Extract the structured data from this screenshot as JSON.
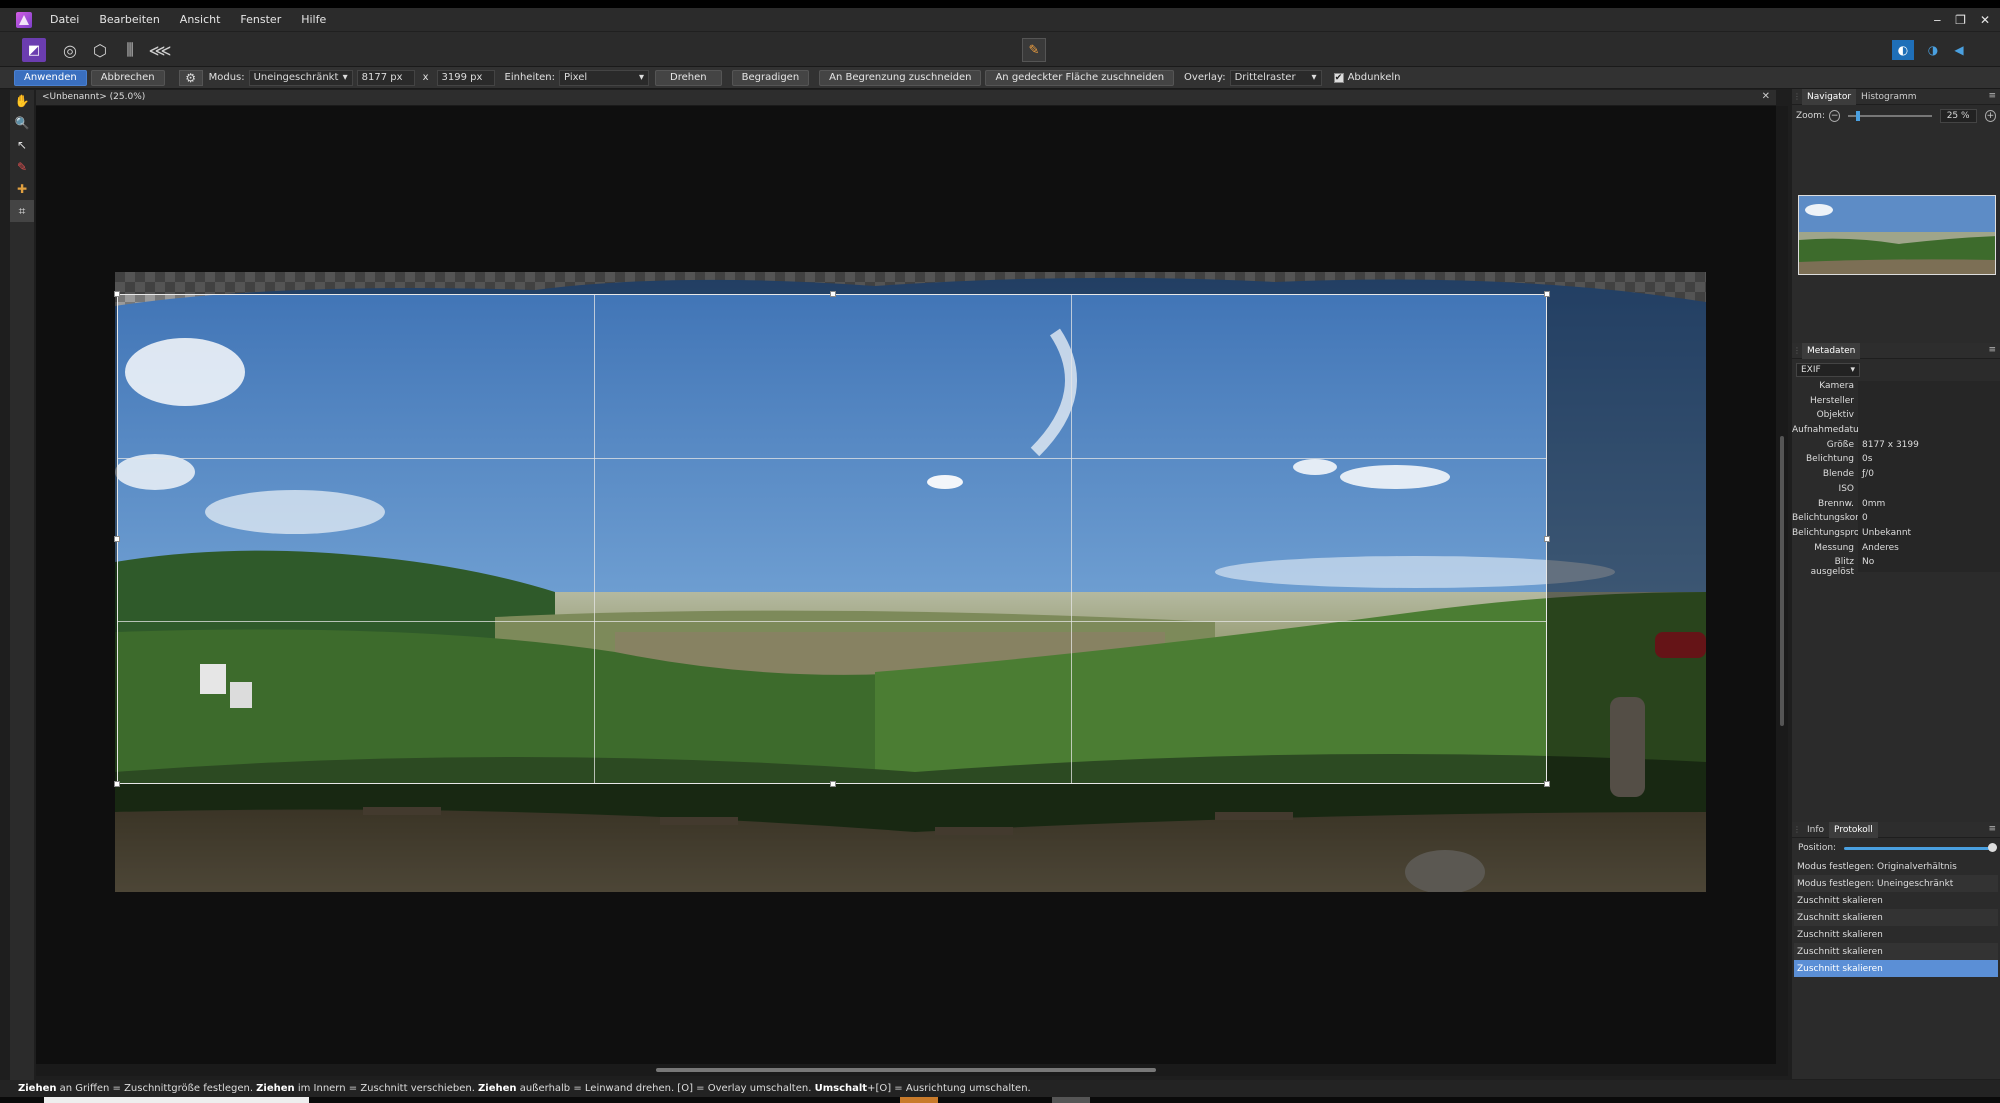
{
  "menubar": {
    "items": [
      "Datei",
      "Bearbeiten",
      "Ansicht",
      "Fenster",
      "Hilfe"
    ],
    "window_controls": [
      "‒",
      "❐",
      "✕"
    ]
  },
  "toolbar": {
    "personas": [
      "photo-persona-icon",
      "liquify-persona-icon",
      "develop-persona-icon",
      "tone-mapping-persona-icon",
      "export-persona-icon"
    ]
  },
  "context_toolbar": {
    "apply_label": "Anwenden",
    "cancel_label": "Abbrechen",
    "mode_label": "Modus:",
    "mode_value": "Uneingeschränkt",
    "width_value": "8177 px",
    "x_label": "x",
    "height_value": "3199 px",
    "units_label": "Einheiten:",
    "units_value": "Pixel",
    "rotate_label": "Drehen",
    "straighten_label": "Begradigen",
    "crop_to_bounds_label": "An Begrenzung zuschneiden",
    "crop_to_covered_label": "An gedeckter Fläche zuschneiden",
    "overlay_label": "Overlay:",
    "overlay_value": "Drittelraster",
    "darken_label": "Abdunkeln",
    "darken_checked": true
  },
  "document": {
    "tab_title": "<Unbenannt> (25.0%)"
  },
  "navigator": {
    "tabs": [
      "Navigator",
      "Histogramm"
    ],
    "zoom_label": "Zoom:",
    "zoom_value": "25 %"
  },
  "metadata": {
    "tab": "Metadaten",
    "select_value": "EXIF",
    "rows": [
      {
        "key": "Kamera",
        "value": ""
      },
      {
        "key": "Hersteller",
        "value": ""
      },
      {
        "key": "Objektiv",
        "value": ""
      },
      {
        "key": "Aufnahmedatum",
        "value": ""
      },
      {
        "key": "Größe",
        "value": "8177 x 3199"
      },
      {
        "key": "Belichtung",
        "value": "0s"
      },
      {
        "key": "Blende",
        "value": "ƒ/0"
      },
      {
        "key": "ISO",
        "value": ""
      },
      {
        "key": "Brennw.",
        "value": "0mm"
      },
      {
        "key": "Belichtungskor.",
        "value": "0"
      },
      {
        "key": "Belichtungsprog.",
        "value": "Unbekannt"
      },
      {
        "key": "Messung",
        "value": "Anderes"
      },
      {
        "key": "Blitz ausgelöst",
        "value": "No"
      }
    ]
  },
  "history": {
    "tabs": [
      "Info",
      "Protokoll"
    ],
    "position_label": "Position:",
    "items": [
      "Modus festlegen: Originalverhältnis",
      "Modus festlegen: Uneingeschränkt",
      "Zuschnitt skalieren",
      "Zuschnitt skalieren",
      "Zuschnitt skalieren",
      "Zuschnitt skalieren",
      "Zuschnitt skalieren"
    ],
    "active_index": 6
  },
  "statusbar": {
    "b1": "Ziehen",
    "t1": " an Griffen = Zuschnittgröße festlegen. ",
    "b2": "Ziehen",
    "t2": " im Innern = Zuschnitt verschieben. ",
    "b3": "Ziehen",
    "t3": " außerhalb = Leinwand drehen. [O] = Overlay umschalten. ",
    "b4": "Umschalt",
    "t4": "+[O] = Ausrichtung umschalten."
  }
}
